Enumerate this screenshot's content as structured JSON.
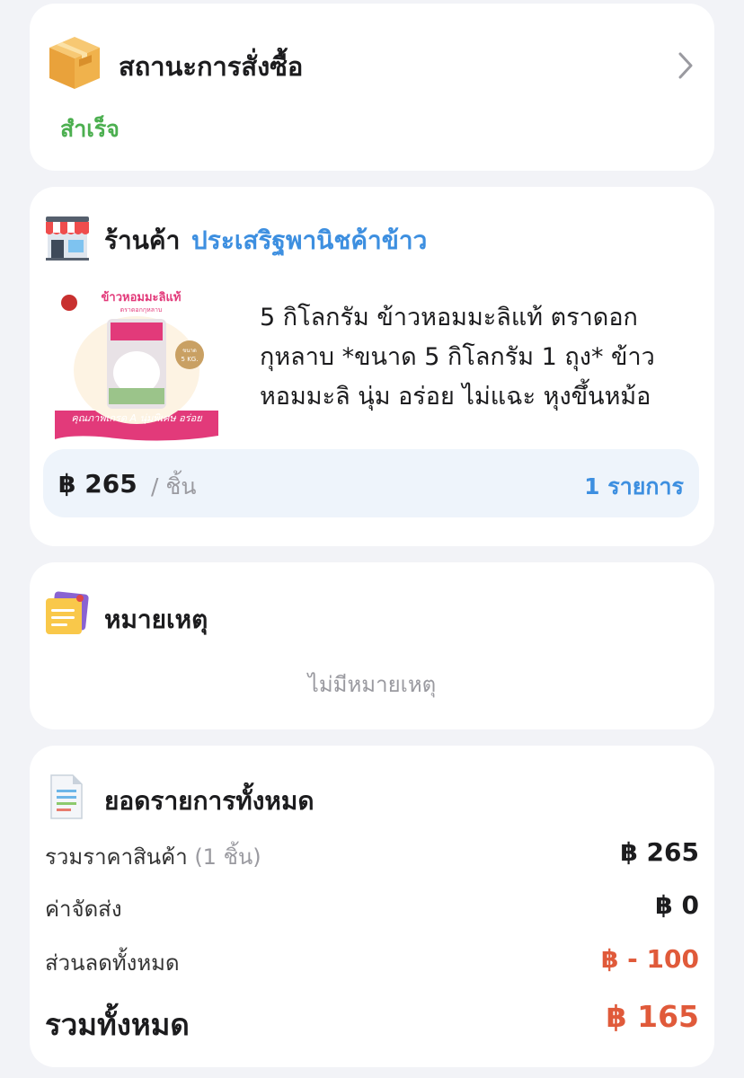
{
  "order_status": {
    "title": "สถานะการสั่งซื้อ",
    "status": "สำเร็จ",
    "icon": "box-icon",
    "status_color": "#4caf50"
  },
  "shop": {
    "label": "ร้านค้า",
    "name": "ประเสริฐพานิชค้าข้าว",
    "icon": "store-icon",
    "name_color": "#3d8fe0"
  },
  "product": {
    "title": "5 กิโลกรัม ข้าวหอมมะลิแท้ ตราดอกกุหลาบ *ขนาด 5 กิโลกรัม 1 ถุง* ข้าวหอมมะลิ นุ่ม อร่อย ไม่แฉะ หุงขึ้นหม้อ",
    "image": {
      "brand_text": "ข้าวหอมมะลิแท้",
      "sub_text": "ตราดอกกุหลาบ",
      "weight_badge": "5 KG.",
      "weight_badge_top": "ขนาด",
      "footer_text": "คุณภาพเกรด A นุ่มพิเศษ อร่อย"
    },
    "price": "฿ 265",
    "unit": "/ ชิ้น",
    "quantity": "1 รายการ"
  },
  "notes": {
    "title": "หมายเหตุ",
    "empty_text": "ไม่มีหมายเหตุ",
    "icon": "note-icon"
  },
  "summary": {
    "title": "ยอดรายการทั้งหมด",
    "icon": "document-icon",
    "rows": [
      {
        "label": "รวมราคาสินค้า",
        "sub": "(1 ชิ้น)",
        "value": "฿ 265"
      },
      {
        "label": "ค่าจัดส่ง",
        "value": "฿ 0"
      },
      {
        "label": "ส่วนลดทั้งหมด",
        "value": "฿ - 100"
      }
    ],
    "grand_label": "รวมทั้งหมด",
    "grand_value": "฿ 165",
    "accent_color": "#e05a3a"
  }
}
